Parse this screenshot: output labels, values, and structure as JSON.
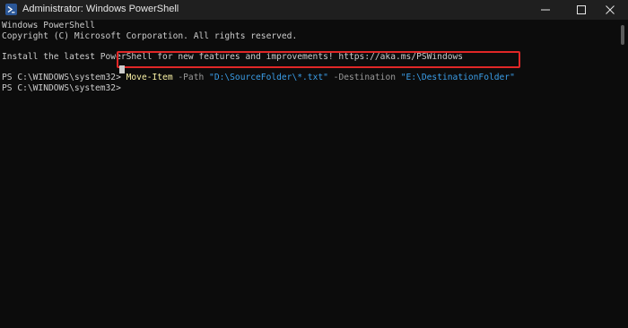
{
  "window": {
    "title": "Administrator: Windows PowerShell",
    "icon": "powershell-icon"
  },
  "controls": {
    "minimize_icon": "minimize-icon",
    "maximize_icon": "maximize-icon",
    "close_icon": "close-icon"
  },
  "console": {
    "banner_line1": "Windows PowerShell",
    "banner_line2": "Copyright (C) Microsoft Corporation. All rights reserved.",
    "install_message": "Install the latest PowerShell for new features and improvements! https://aka.ms/PSWindows",
    "command_prompt": "PS C:\\WINDOWS\\system32> ",
    "command": {
      "cmdlet": "Move-Item",
      "path_param": " -Path ",
      "path_value": "\"D:\\SourceFolder\\*.txt\"",
      "dest_param": " -Destination ",
      "dest_value": "\"E:\\DestinationFolder\""
    },
    "current_prompt": "PS C:\\WINDOWS\\system32>"
  },
  "colors": {
    "background": "#0c0c0c",
    "text": "#cccccc",
    "cmdlet": "#f9f1a5",
    "parameter": "#9a9a9a",
    "string": "#3b9ee8",
    "highlight_border": "#e02727"
  }
}
